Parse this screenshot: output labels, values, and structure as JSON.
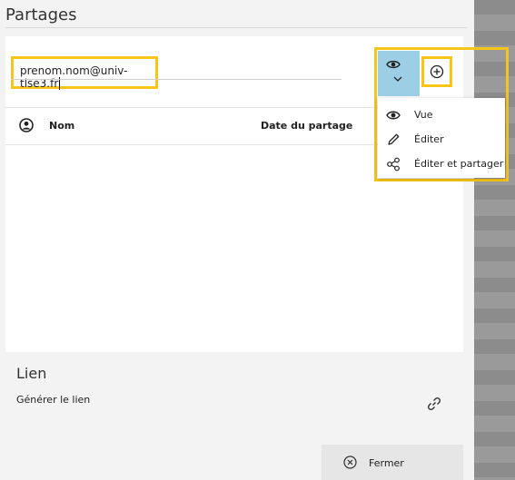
{
  "dialog": {
    "title": "Partages"
  },
  "share_form": {
    "email_value": "prenom.nom@univ-tlse3.fr",
    "permission_icon": "eye-icon",
    "add_icon": "add-circle-icon"
  },
  "table": {
    "columns": [
      "Nom",
      "Date du partage"
    ],
    "rows": []
  },
  "permission_menu": {
    "items": [
      {
        "label": "Vue",
        "icon": "eye-icon"
      },
      {
        "label": "Éditer",
        "icon": "pencil-icon"
      },
      {
        "label": "Éditer et partager",
        "icon": "share-icon"
      }
    ]
  },
  "link_section": {
    "title": "Lien",
    "generate_label": "Générer le lien",
    "icon": "link-icon"
  },
  "footer": {
    "close_label": "Fermer",
    "close_icon": "close-circle-icon"
  },
  "colors": {
    "highlight": "#f5c518",
    "selected_button": "#9ccfe6"
  }
}
